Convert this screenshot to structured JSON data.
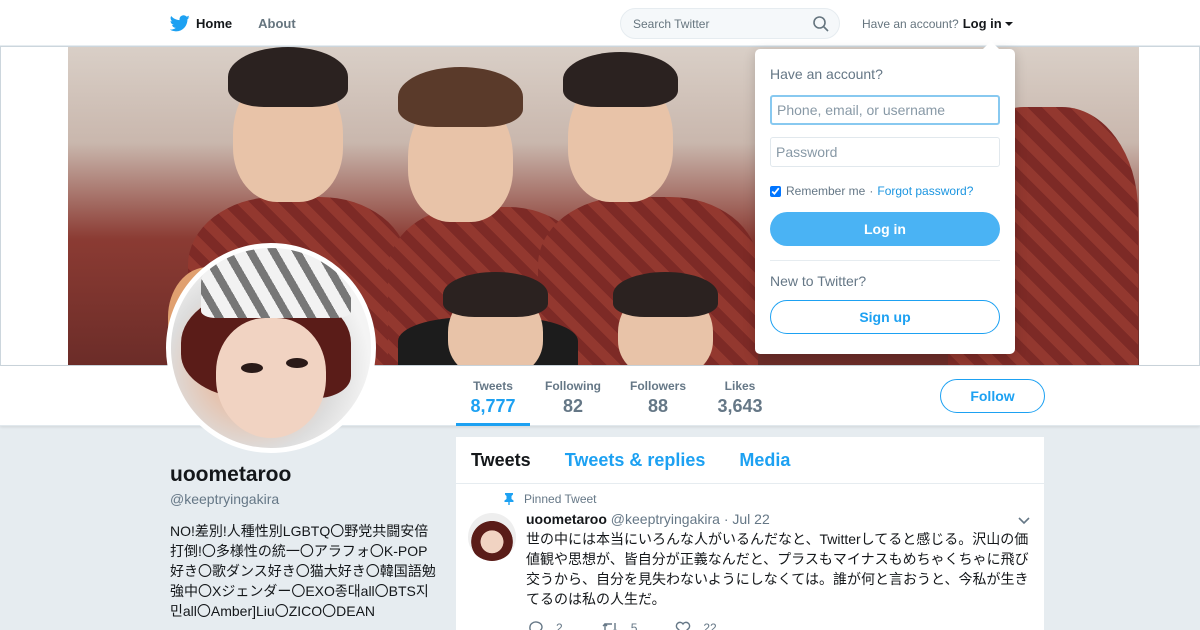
{
  "nav": {
    "home": "Home",
    "about": "About",
    "search_placeholder": "Search Twitter",
    "have_account": "Have an account?",
    "login": "Log in"
  },
  "login_dropdown": {
    "title": "Have an account?",
    "username_placeholder": "Phone, email, or username",
    "password_placeholder": "Password",
    "remember_me": "Remember me",
    "separator": "·",
    "forgot_password": "Forgot password?",
    "login_button": "Log in",
    "new_to_twitter": "New to Twitter?",
    "signup_button": "Sign up"
  },
  "stats": [
    {
      "label": "Tweets",
      "value": "8,777"
    },
    {
      "label": "Following",
      "value": "82"
    },
    {
      "label": "Followers",
      "value": "88"
    },
    {
      "label": "Likes",
      "value": "3,643"
    }
  ],
  "follow_button": "Follow",
  "profile": {
    "name": "uoometaroo",
    "handle": "@keeptryingakira",
    "bio": "NO!差別!人種性別LGBTQ〇野党共闘安倍打倒!〇多様性の統一〇アラフォ〇K-POP好き〇歌ダンス好き〇猫大好き〇韓国語勉強中〇Xジェンダー〇EXO종대all〇BTS지민all〇Amber]Liu〇ZICO〇DEAN"
  },
  "timeline": {
    "tabs": [
      "Tweets",
      "Tweets & replies",
      "Media"
    ],
    "pinned_label": "Pinned Tweet",
    "tweet": {
      "name": "uoometaroo",
      "handle": "@keeptryingakira",
      "dot": "·",
      "date": "Jul 22",
      "text": "世の中には本当にいろんな人がいるんだなと、Twitterしてると感じる。沢山の価値観や思想が、皆自分が正義なんだと、プラスもマイナスもめちゃくちゃに飛び交うから、自分を見失わないようにしなくては。誰が何と言おうと、今私が生きてるのは私の人生だ。",
      "replies": "2",
      "retweets": "5",
      "likes": "22"
    }
  },
  "colors": {
    "accent": "#1da1f2",
    "login_button": "#4ab3f4",
    "background": "#e6ecf0"
  }
}
